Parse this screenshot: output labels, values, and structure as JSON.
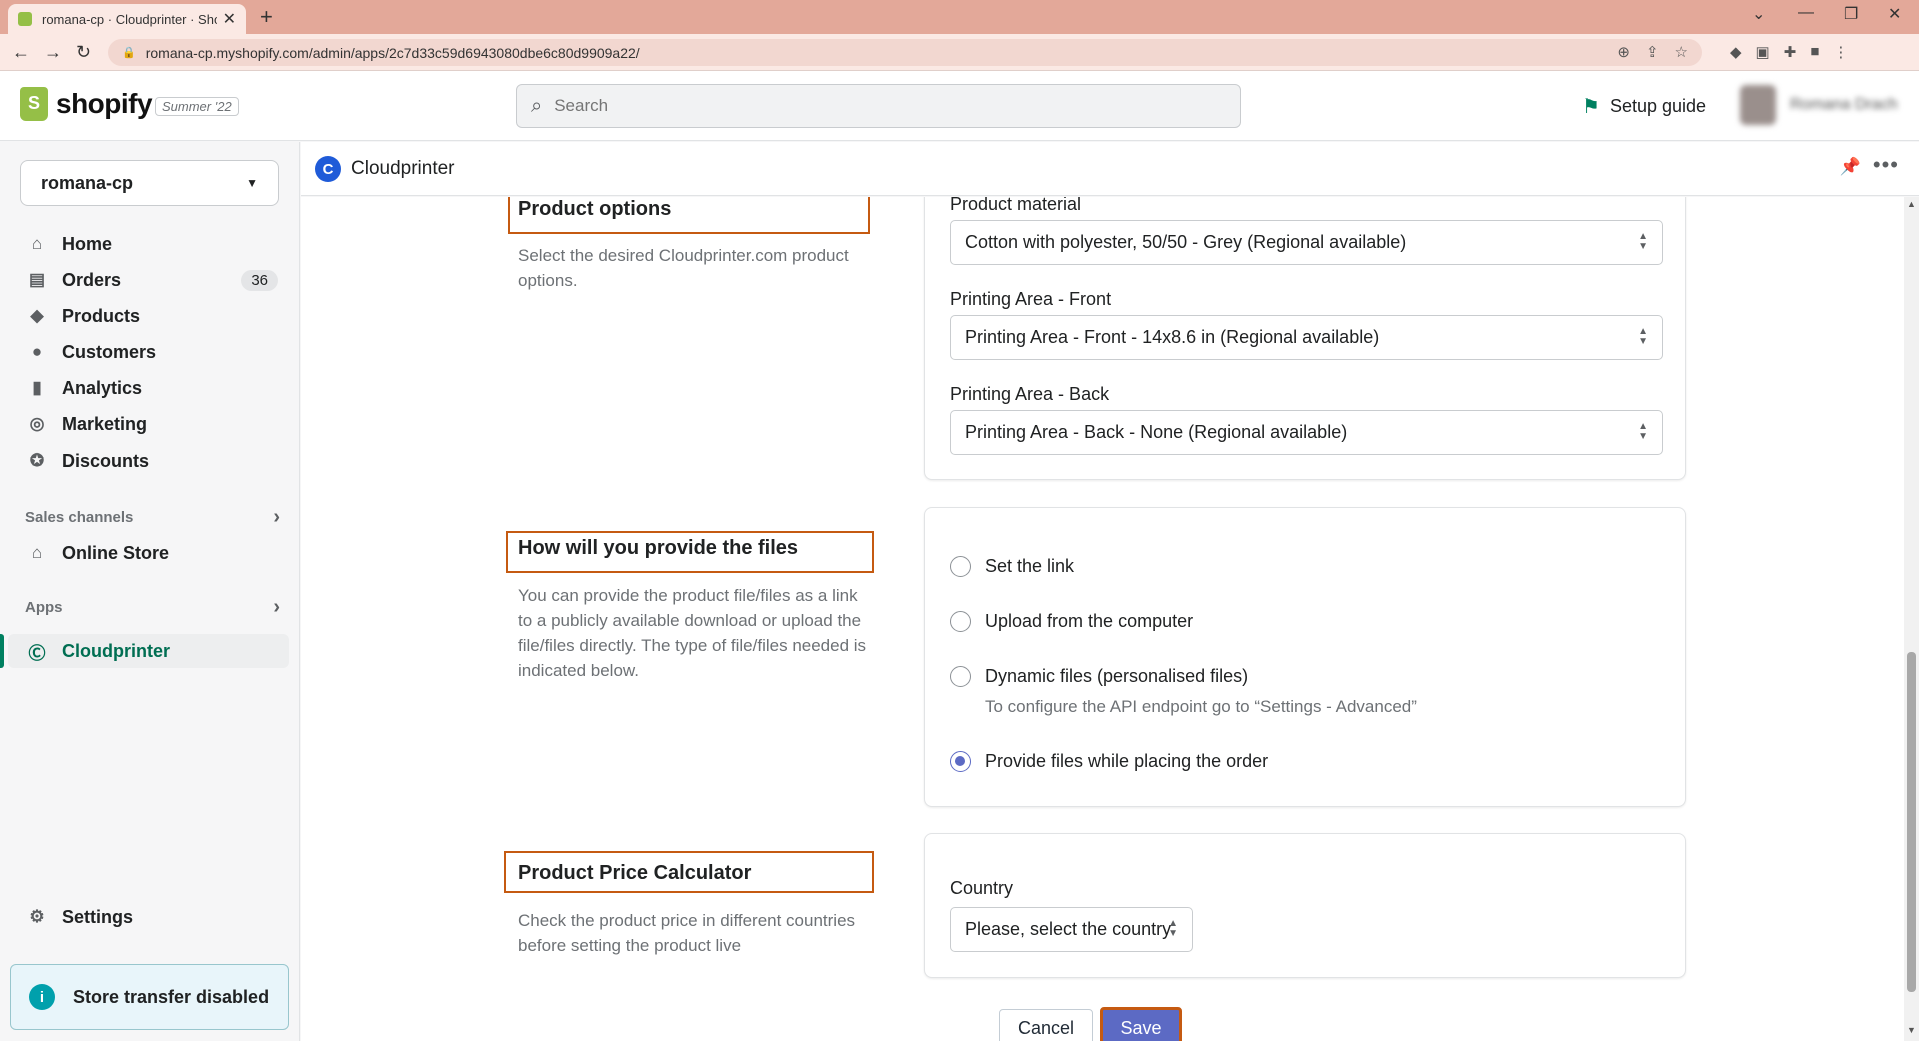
{
  "browser": {
    "tab_title": "romana-cp · Cloudprinter · Shopi",
    "url": "romana-cp.myshopify.com/admin/apps/2c7d33c59d6943080dbe6c80d9909a22/"
  },
  "topbar": {
    "logo_text": "shopify",
    "edition_badge": "Summer '22",
    "search_placeholder": "Search",
    "setup_guide": "Setup guide",
    "account_name": "Romana Drach"
  },
  "sidebar": {
    "store_name": "romana-cp",
    "nav": [
      {
        "label": "Home",
        "icon": "home-icon"
      },
      {
        "label": "Orders",
        "icon": "orders-icon",
        "count": "36"
      },
      {
        "label": "Products",
        "icon": "tag-icon"
      },
      {
        "label": "Customers",
        "icon": "person-icon"
      },
      {
        "label": "Analytics",
        "icon": "bar-chart-icon"
      },
      {
        "label": "Marketing",
        "icon": "target-icon"
      },
      {
        "label": "Discounts",
        "icon": "discount-icon"
      }
    ],
    "sales_channels_label": "Sales channels",
    "online_store": "Online Store",
    "apps_label": "Apps",
    "cloudprinter": "Cloudprinter",
    "settings": "Settings",
    "store_transfer": "Store transfer disabled"
  },
  "app_header": {
    "title": "Cloudprinter"
  },
  "product_options": {
    "title": "Product options",
    "description": "Select the desired Cloudprinter.com product options.",
    "material_label": "Product material",
    "material_value": "Cotton with polyester, 50/50 - Grey (Regional available)",
    "front_label": "Printing Area - Front",
    "front_value": "Printing Area - Front - 14x8.6 in (Regional available)",
    "back_label": "Printing Area - Back",
    "back_value": "Printing Area - Back - None (Regional available)"
  },
  "files": {
    "title": "How will you provide the files",
    "description": "You can provide the product file/files as a link to a publicly available download or upload the file/files directly. The type of file/files needed is indicated below.",
    "options": [
      {
        "label": "Set the link",
        "checked": false
      },
      {
        "label": "Upload from the computer",
        "checked": false
      },
      {
        "label": "Dynamic files (personalised files)",
        "checked": false
      },
      {
        "label": "Provide files while placing the order",
        "checked": true
      }
    ],
    "dynamic_help": "To configure the API endpoint go to “Settings - Advanced”"
  },
  "calculator": {
    "title": "Product Price Calculator",
    "description": "Check the product price in different countries before setting the product live",
    "country_label": "Country",
    "country_value": "Please, select the country"
  },
  "actions": {
    "cancel": "Cancel",
    "save": "Save"
  }
}
